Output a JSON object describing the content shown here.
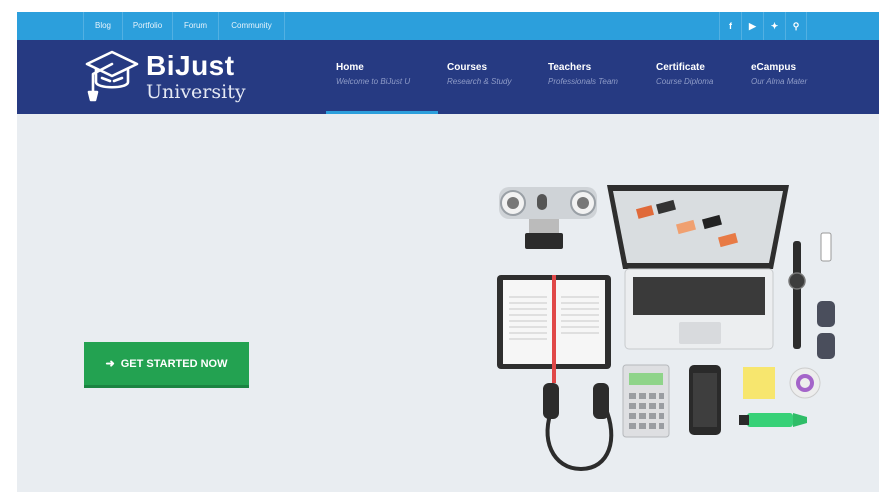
{
  "topbar": {
    "links": [
      {
        "label": "Blog"
      },
      {
        "label": "Portfolio"
      },
      {
        "label": "Forum"
      },
      {
        "label": "Community"
      }
    ],
    "social": [
      "facebook-icon",
      "youtube-icon",
      "twitter-icon",
      "search-icon"
    ],
    "social_glyphs": {
      "facebook": "f",
      "youtube": "▶",
      "twitter": "✦",
      "search": "⚲"
    }
  },
  "logo": {
    "line1": "BiJust",
    "line2": "University"
  },
  "nav": [
    {
      "title": "Home",
      "subtitle": "Welcome to BiJust U",
      "active": true
    },
    {
      "title": "Courses",
      "subtitle": "Research & Study"
    },
    {
      "title": "Teachers",
      "subtitle": "Professionals Team"
    },
    {
      "title": "Certificate",
      "subtitle": "Course Diploma"
    },
    {
      "title": "eCampus",
      "subtitle": "Our Alma Mater"
    }
  ],
  "hero": {
    "cta_label": "GET STARTED NOW",
    "cta_icon": "arrow-right-icon"
  },
  "colors": {
    "topbar": "#2c9fdc",
    "nav": "#263a82",
    "hero_bg": "#e9edf1",
    "cta": "#23a251"
  }
}
